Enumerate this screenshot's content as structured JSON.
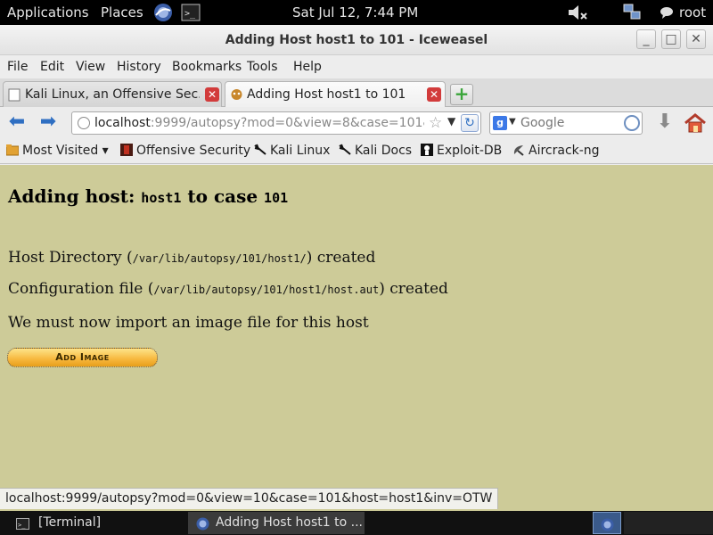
{
  "top_panel": {
    "applications": "Applications",
    "places": "Places",
    "clock": "Sat Jul 12,  7:44 PM",
    "user": "root"
  },
  "window": {
    "title": "Adding Host host1 to 101 - Iceweasel"
  },
  "menu": [
    "File",
    "Edit",
    "View",
    "History",
    "Bookmarks",
    "Tools",
    "Help"
  ],
  "tabs": [
    {
      "label": "Kali Linux, an Offensive Sec..."
    },
    {
      "label": "Adding Host host1 to 101"
    }
  ],
  "nav": {
    "url_host": "localhost",
    "url_rest": ":9999/autopsy?mod=0&view=8&case=101&in",
    "search_placeholder": "Google"
  },
  "bookmarks": [
    "Most Visited",
    "Offensive Security",
    "Kali Linux",
    "Kali Docs",
    "Exploit-DB",
    "Aircrack-ng"
  ],
  "page": {
    "heading_prefix": "Adding host: ",
    "heading_host": "host1",
    "heading_mid": " to case ",
    "heading_case": "101",
    "host_dir_prefix": "Host Directory (",
    "host_dir_path": "/var/lib/autopsy/101/host1/",
    "host_dir_suffix": ") created",
    "config_prefix": "Configuration file (",
    "config_path": "/var/lib/autopsy/101/host1/host.aut",
    "config_suffix": ") created",
    "import_msg": "We must now import an image file for this host",
    "add_image_label": "Add Image"
  },
  "status_url": "localhost:9999/autopsy?mod=0&view=10&case=101&host=host1&inv=OTW",
  "taskbar": {
    "terminal": "[Terminal]",
    "browser": "Adding Host host1 to ..."
  },
  "colors": {
    "page_bg": "#cdcb98",
    "button_gold": "#f7b73c"
  }
}
